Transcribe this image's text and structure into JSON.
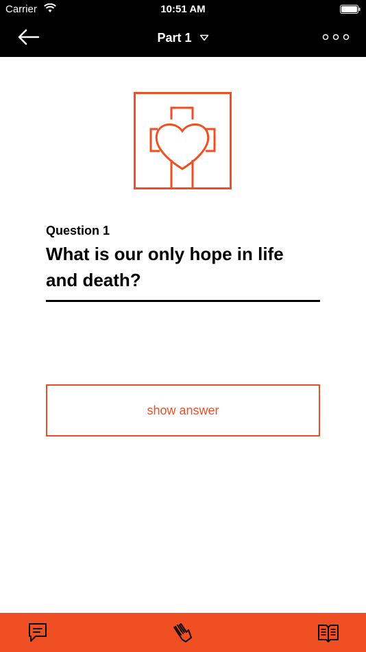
{
  "status_bar": {
    "carrier": "Carrier",
    "time": "10:51 AM"
  },
  "nav": {
    "title": "Part 1",
    "back_icon": "arrow-left-icon",
    "more_icon": "more-dots-icon",
    "dropdown_icon": "chevron-down-icon"
  },
  "question": {
    "label": "Question 1",
    "text": "What is our only hope in life and death?"
  },
  "answer_button": {
    "label": "show answer"
  },
  "tab_bar": {
    "items": [
      {
        "name": "chat",
        "icon": "speech-bubble-icon"
      },
      {
        "name": "pray",
        "icon": "praying-hands-icon"
      },
      {
        "name": "book",
        "icon": "open-book-icon"
      }
    ]
  },
  "colors": {
    "accent": "#f04e23",
    "header_bg": "#000000",
    "text": "#000000",
    "background": "#ffffff"
  }
}
